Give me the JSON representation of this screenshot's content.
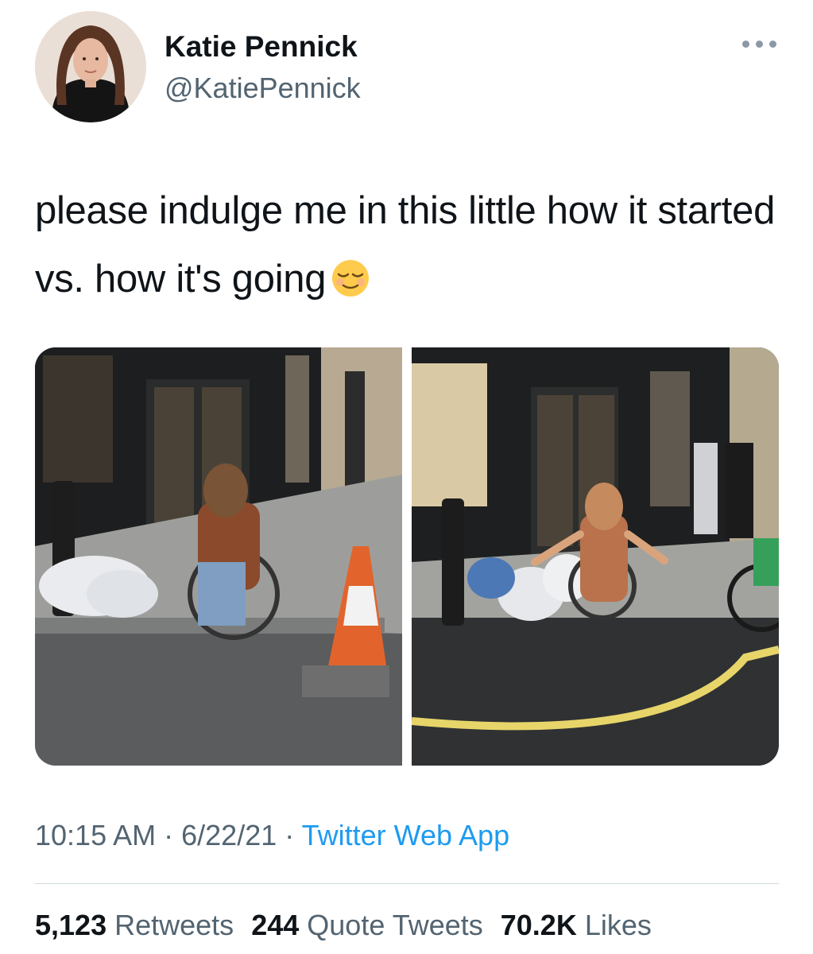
{
  "author": {
    "name": "Katie Pennick",
    "handle": "@KatiePennick"
  },
  "tweet": {
    "text": "please indulge me in this little how it started vs. how it's going",
    "emoji": "relieved-face-emoji"
  },
  "media": [
    {
      "icon": "photo-before"
    },
    {
      "icon": "photo-after"
    }
  ],
  "meta": {
    "time": "10:15 AM",
    "separator": "·",
    "date": "6/22/21",
    "source": "Twitter Web App"
  },
  "stats": {
    "retweets_count": "5,123",
    "retweets_label": "Retweets",
    "quotes_count": "244",
    "quotes_label": "Quote Tweets",
    "likes_count": "70.2K",
    "likes_label": "Likes"
  },
  "colors": {
    "link": "#1d9bf0",
    "secondary_text": "#536471",
    "primary_text": "#0f1419"
  }
}
